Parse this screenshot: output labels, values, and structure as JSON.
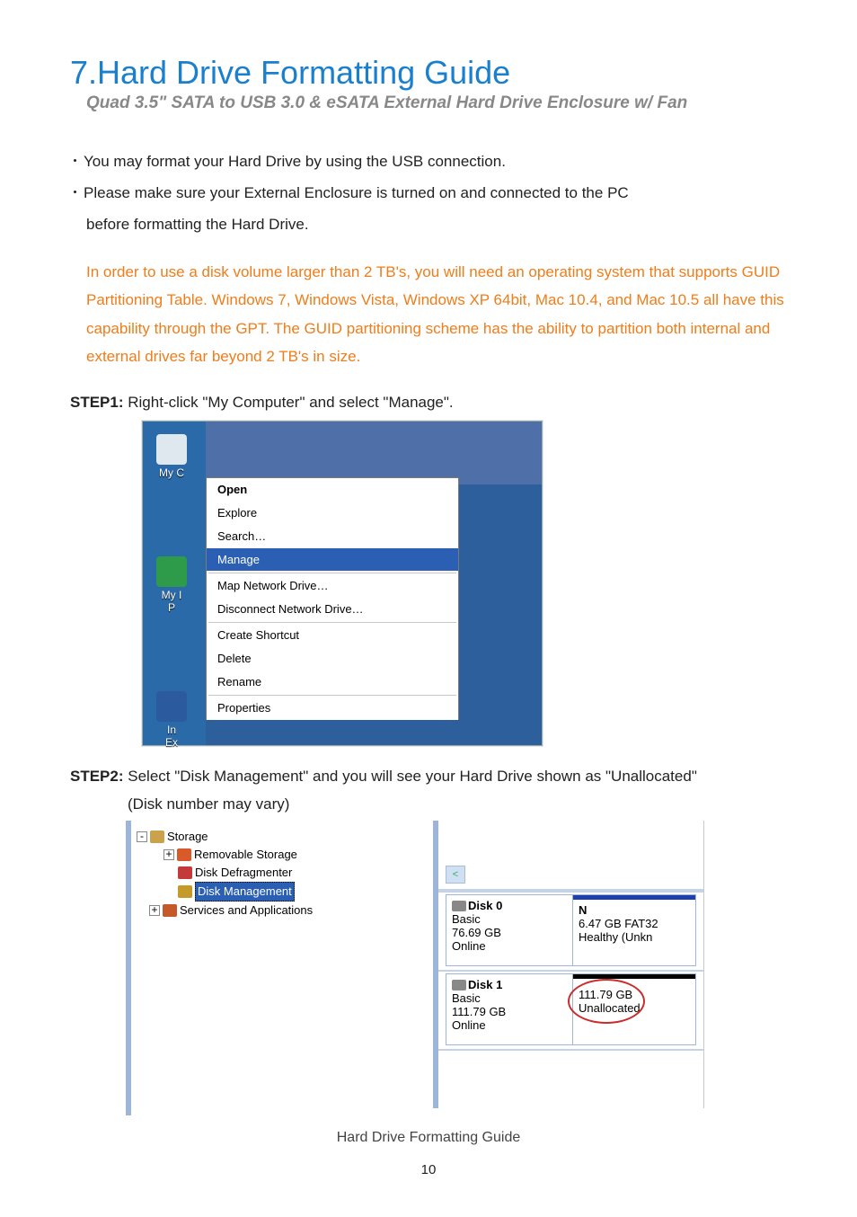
{
  "title": "7.Hard Drive Formatting Guide",
  "subtitle": "Quad 3.5\" SATA to USB 3.0 & eSATA External Hard Drive Enclosure w/ Fan",
  "bullets": [
    "You may format your Hard Drive by using the USB connection.",
    "Please make sure your External Enclosure is turned on and connected to the  PC"
  ],
  "bullet2_cont": "before formatting the Hard Drive.",
  "warning": "In order to use a disk volume larger than 2 TB's, you will need an operating system that supports GUID Partitioning Table.  Windows 7, Windows Vista, Windows XP 64bit, Mac 10.4, and Mac 10.5 all have this capability through the GPT. The GUID partitioning scheme has the ability to partition both internal and external drives far beyond 2 TB's in size.",
  "step1_label": "STEP1:",
  "step1_text": " Right-click \"My Computer\" and select \"Manage\".",
  "step2_label": "STEP2:",
  "step2_text": " Select \"Disk Management\" and you will see your Hard Drive shown as \"Unallocated\"",
  "step2_cont": "(Disk number may vary)",
  "desktop": {
    "icon1": "My C",
    "icon2": "My I\nP",
    "icon3": "In\nEx"
  },
  "context_menu": {
    "items": [
      {
        "label": "Open",
        "bold": true
      },
      {
        "label": "Explore"
      },
      {
        "label": "Search…"
      },
      {
        "label": "Manage",
        "selected": true
      },
      {
        "sep": true
      },
      {
        "label": "Map Network Drive…"
      },
      {
        "label": "Disconnect Network Drive…"
      },
      {
        "sep": true
      },
      {
        "label": "Create Shortcut"
      },
      {
        "label": "Delete"
      },
      {
        "label": "Rename"
      },
      {
        "sep": true
      },
      {
        "label": "Properties"
      }
    ]
  },
  "tree": {
    "storage": "Storage",
    "removable": "Removable Storage",
    "defrag": "Disk Defragmenter",
    "diskmgmt": "Disk Management",
    "services": "Services and Applications"
  },
  "disks": {
    "scroll_arrow": "<",
    "d0": {
      "title": "Disk 0",
      "type": "Basic",
      "size": "76.69 GB",
      "status": "Online",
      "vol_name": "N",
      "vol_line2": "6.47 GB FAT32",
      "vol_line3": "Healthy (Unkn"
    },
    "d1": {
      "title": "Disk 1",
      "type": "Basic",
      "size": "111.79 GB",
      "status": "Online",
      "vol_line1": "111.79 GB",
      "vol_line2": "Unallocated"
    }
  },
  "footer": "Hard Drive Formatting Guide",
  "page_number": "10"
}
